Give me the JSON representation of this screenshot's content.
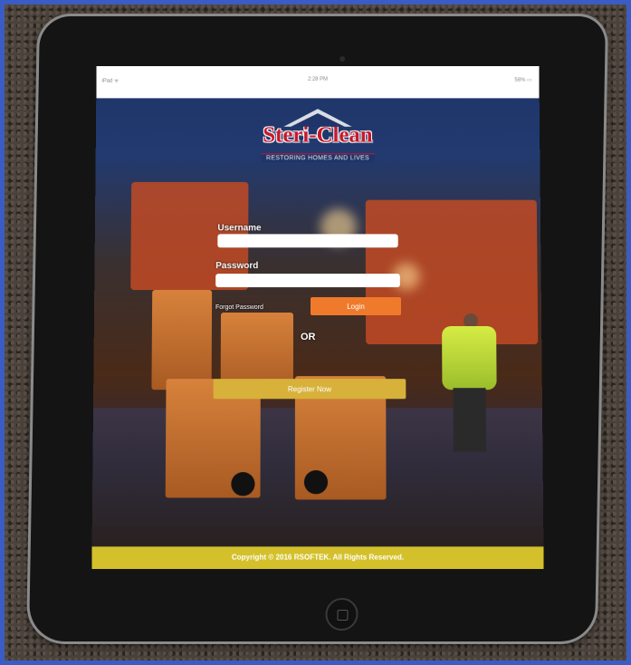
{
  "statusbar": {
    "carrier": "iPad ᯤ",
    "time": "2:28 PM",
    "battery": "58% ▭"
  },
  "logo": {
    "brand": "Steri-Clean",
    "tagline": "RESTORING HOMES AND LIVES"
  },
  "form": {
    "username_label": "Username",
    "username_value": "",
    "password_label": "Password",
    "password_value": "",
    "forgot_label": "Forgot Password",
    "login_label": "Login",
    "or_label": "OR",
    "register_label": "Register Now"
  },
  "footer": {
    "copyright": "Copyright © 2016 RSOFTEK. All Rights Reserved."
  },
  "colors": {
    "login": "#f07a2c",
    "register": "#d7b13a",
    "footer": "#d4c02a",
    "brand": "#c4192b"
  }
}
